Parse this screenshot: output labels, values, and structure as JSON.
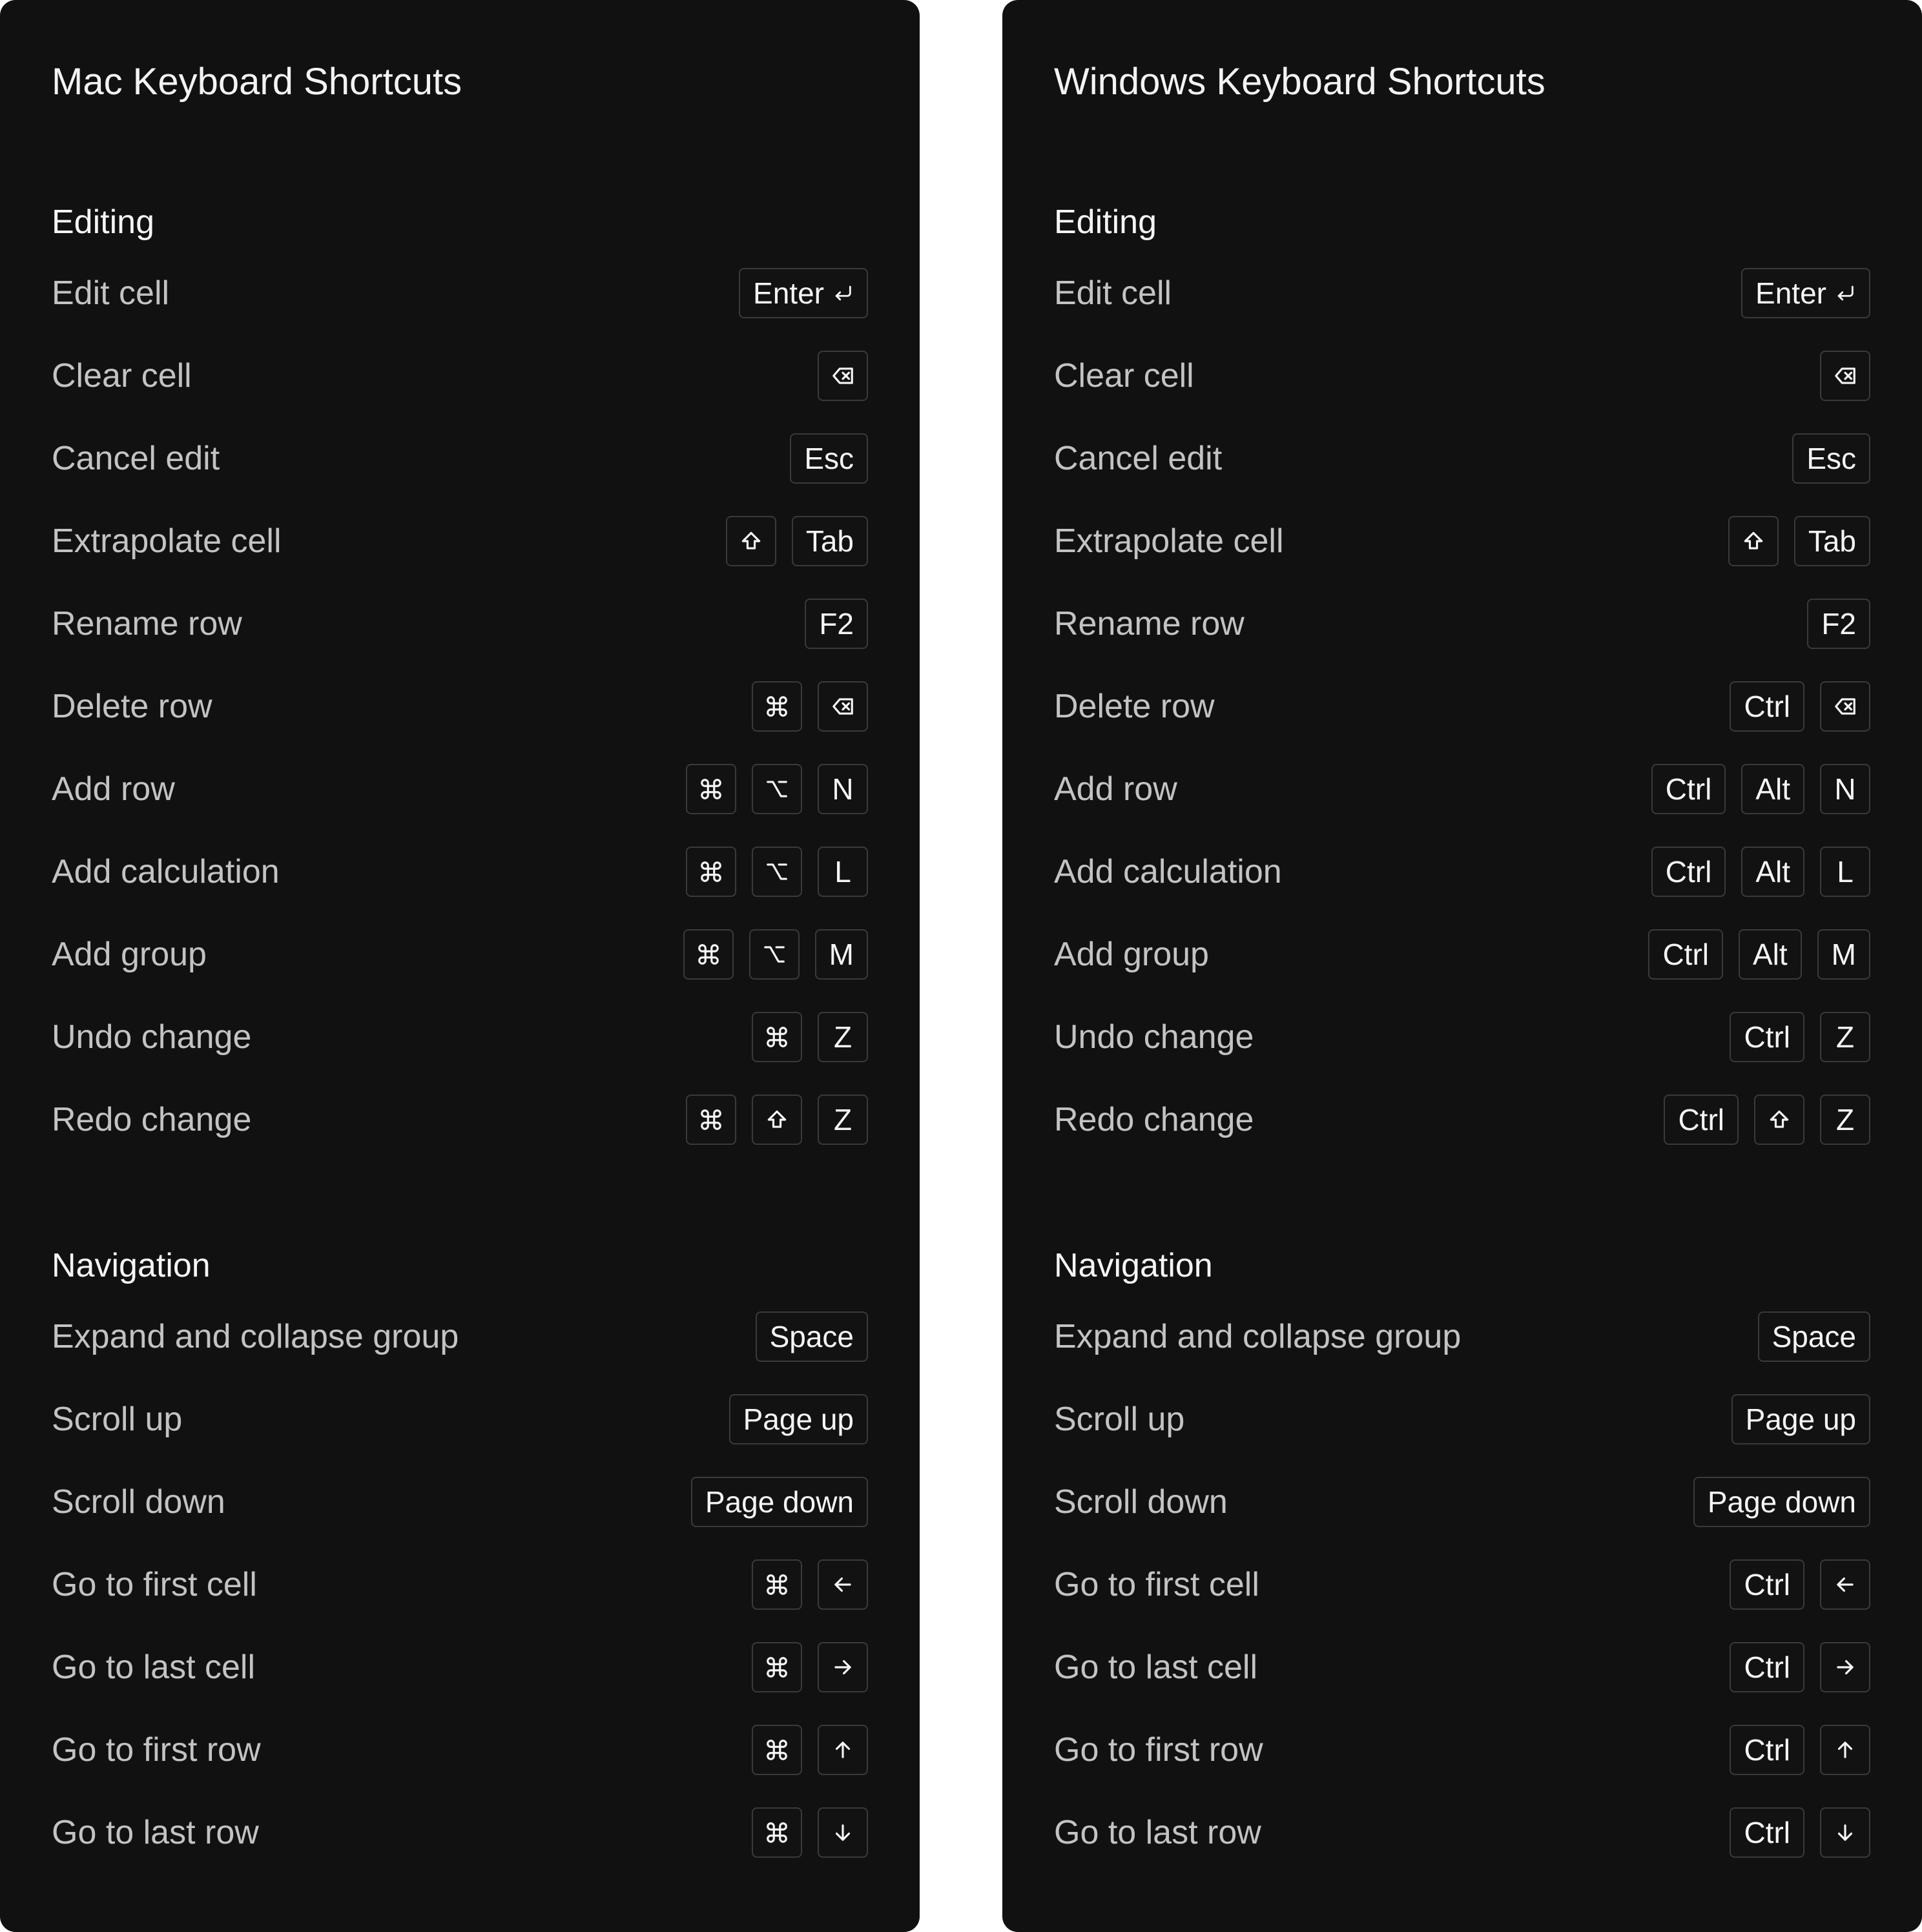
{
  "mac": {
    "title": "Mac Keyboard Shortcuts",
    "sections": [
      {
        "title": "Editing",
        "rows": [
          {
            "label": "Edit cell",
            "keys": [
              {
                "text": "Enter",
                "icon": "return-icon"
              }
            ]
          },
          {
            "label": "Clear cell",
            "keys": [
              {
                "icon": "backspace-icon"
              }
            ]
          },
          {
            "label": "Cancel edit",
            "keys": [
              {
                "text": "Esc"
              }
            ]
          },
          {
            "label": "Extrapolate cell",
            "keys": [
              {
                "icon": "shift-icon"
              },
              {
                "text": "Tab"
              }
            ]
          },
          {
            "label": "Rename row",
            "keys": [
              {
                "text": "F2"
              }
            ]
          },
          {
            "label": "Delete row",
            "keys": [
              {
                "icon": "command-icon"
              },
              {
                "icon": "backspace-icon"
              }
            ]
          },
          {
            "label": "Add row",
            "keys": [
              {
                "icon": "command-icon"
              },
              {
                "icon": "option-icon"
              },
              {
                "text": "N"
              }
            ]
          },
          {
            "label": "Add calculation",
            "keys": [
              {
                "icon": "command-icon"
              },
              {
                "icon": "option-icon"
              },
              {
                "text": "L"
              }
            ]
          },
          {
            "label": "Add group",
            "keys": [
              {
                "icon": "command-icon"
              },
              {
                "icon": "option-icon"
              },
              {
                "text": "M"
              }
            ]
          },
          {
            "label": "Undo change",
            "keys": [
              {
                "icon": "command-icon"
              },
              {
                "text": "Z"
              }
            ]
          },
          {
            "label": "Redo change",
            "keys": [
              {
                "icon": "command-icon"
              },
              {
                "icon": "shift-icon"
              },
              {
                "text": "Z"
              }
            ]
          }
        ]
      },
      {
        "title": "Navigation",
        "rows": [
          {
            "label": "Expand and collapse group",
            "keys": [
              {
                "text": "Space"
              }
            ]
          },
          {
            "label": "Scroll up",
            "keys": [
              {
                "text": "Page up"
              }
            ]
          },
          {
            "label": "Scroll down",
            "keys": [
              {
                "text": "Page down"
              }
            ]
          },
          {
            "label": "Go to first cell",
            "keys": [
              {
                "icon": "command-icon"
              },
              {
                "icon": "arrow-left-icon"
              }
            ]
          },
          {
            "label": "Go to last cell",
            "keys": [
              {
                "icon": "command-icon"
              },
              {
                "icon": "arrow-right-icon"
              }
            ]
          },
          {
            "label": "Go to first row",
            "keys": [
              {
                "icon": "command-icon"
              },
              {
                "icon": "arrow-up-icon"
              }
            ]
          },
          {
            "label": "Go to last row",
            "keys": [
              {
                "icon": "command-icon"
              },
              {
                "icon": "arrow-down-icon"
              }
            ]
          }
        ]
      }
    ]
  },
  "windows": {
    "title": "Windows Keyboard Shortcuts",
    "sections": [
      {
        "title": "Editing",
        "rows": [
          {
            "label": "Edit cell",
            "keys": [
              {
                "text": "Enter",
                "icon": "return-icon"
              }
            ]
          },
          {
            "label": "Clear cell",
            "keys": [
              {
                "icon": "backspace-icon"
              }
            ]
          },
          {
            "label": "Cancel edit",
            "keys": [
              {
                "text": "Esc"
              }
            ]
          },
          {
            "label": "Extrapolate cell",
            "keys": [
              {
                "icon": "shift-icon"
              },
              {
                "text": "Tab"
              }
            ]
          },
          {
            "label": "Rename row",
            "keys": [
              {
                "text": "F2"
              }
            ]
          },
          {
            "label": "Delete row",
            "keys": [
              {
                "text": "Ctrl"
              },
              {
                "icon": "backspace-icon"
              }
            ]
          },
          {
            "label": "Add row",
            "keys": [
              {
                "text": "Ctrl"
              },
              {
                "text": "Alt"
              },
              {
                "text": "N"
              }
            ]
          },
          {
            "label": "Add calculation",
            "keys": [
              {
                "text": "Ctrl"
              },
              {
                "text": "Alt"
              },
              {
                "text": "L"
              }
            ]
          },
          {
            "label": "Add group",
            "keys": [
              {
                "text": "Ctrl"
              },
              {
                "text": "Alt"
              },
              {
                "text": "M"
              }
            ]
          },
          {
            "label": "Undo change",
            "keys": [
              {
                "text": "Ctrl"
              },
              {
                "text": "Z"
              }
            ]
          },
          {
            "label": "Redo change",
            "keys": [
              {
                "text": "Ctrl"
              },
              {
                "icon": "shift-icon"
              },
              {
                "text": "Z"
              }
            ]
          }
        ]
      },
      {
        "title": "Navigation",
        "rows": [
          {
            "label": "Expand and collapse group",
            "keys": [
              {
                "text": "Space"
              }
            ]
          },
          {
            "label": "Scroll up",
            "keys": [
              {
                "text": "Page up"
              }
            ]
          },
          {
            "label": "Scroll down",
            "keys": [
              {
                "text": "Page down"
              }
            ]
          },
          {
            "label": "Go to first cell",
            "keys": [
              {
                "text": "Ctrl"
              },
              {
                "icon": "arrow-left-icon"
              }
            ]
          },
          {
            "label": "Go to last cell",
            "keys": [
              {
                "text": "Ctrl"
              },
              {
                "icon": "arrow-right-icon"
              }
            ]
          },
          {
            "label": "Go to first row",
            "keys": [
              {
                "text": "Ctrl"
              },
              {
                "icon": "arrow-up-icon"
              }
            ]
          },
          {
            "label": "Go to last row",
            "keys": [
              {
                "text": "Ctrl"
              },
              {
                "icon": "arrow-down-icon"
              }
            ]
          }
        ]
      }
    ]
  },
  "colors": {
    "panel_background": "#111112",
    "title_text": "#f3f3f3",
    "row_label_text": "#c3c3c3",
    "key_border": "#3a3a3c",
    "key_text": "#f5f5f5"
  }
}
